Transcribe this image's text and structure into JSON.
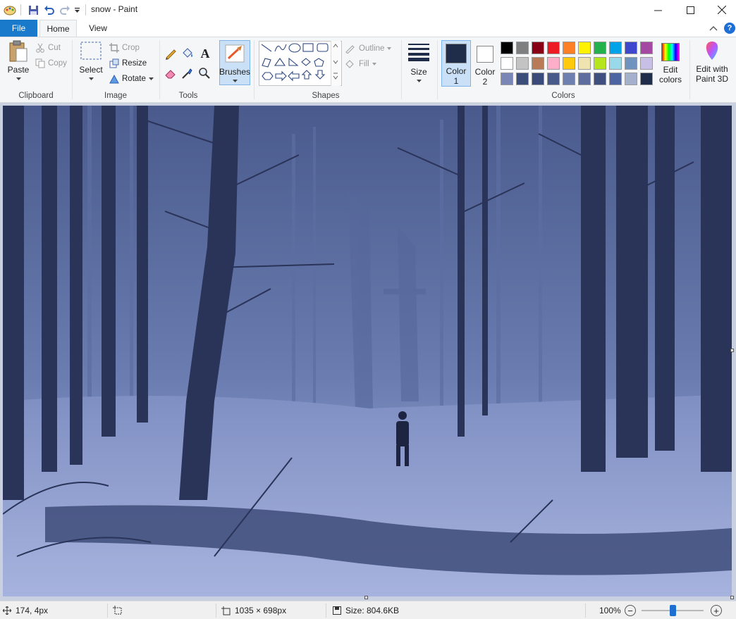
{
  "window": {
    "title": "snow - Paint",
    "minimize": "—",
    "maximize": "☐",
    "close": "✕"
  },
  "tabs": {
    "file": "File",
    "home": "Home",
    "view": "View"
  },
  "ribbon": {
    "clipboard": {
      "label": "Clipboard",
      "paste": "Paste",
      "cut": "Cut",
      "copy": "Copy"
    },
    "image": {
      "label": "Image",
      "select": "Select",
      "crop": "Crop",
      "resize": "Resize",
      "rotate": "Rotate"
    },
    "tools": {
      "label": "Tools"
    },
    "brushes": {
      "label": "Brushes"
    },
    "shapes": {
      "label": "Shapes",
      "outline": "Outline",
      "fill": "Fill"
    },
    "size": {
      "label": "Size"
    },
    "colors": {
      "label": "Colors",
      "color1_label": "Color",
      "color1_num": "1",
      "color2_label": "Color",
      "color2_num": "2",
      "edit_colors_line1": "Edit",
      "edit_colors_line2": "colors",
      "paint3d_line1": "Edit with",
      "paint3d_line2": "Paint 3D",
      "color1": "#1f2d4a",
      "color2": "#ffffff",
      "palette": [
        "#000000",
        "#7f7f7f",
        "#880015",
        "#ed1c24",
        "#ff7f27",
        "#fff200",
        "#22b14c",
        "#00a2e8",
        "#3f48cc",
        "#a349a4",
        "#ffffff",
        "#c3c3c3",
        "#b97a57",
        "#ffaec9",
        "#ffc90e",
        "#efe4b0",
        "#b5e61d",
        "#99d9ea",
        "#7092be",
        "#c8bfe7",
        "#7a86b5",
        "#3b4e79",
        "#3a4a7a",
        "#485a8a",
        "#6d80b0",
        "#5c6d9e",
        "#3e4f80",
        "#4c64a0",
        "#a4b0cc",
        "#1f2d4a"
      ]
    }
  },
  "status": {
    "cursor_pos": "174, 4px",
    "image_dims": "1035 × 698px",
    "file_size": "Size: 804.6KB",
    "zoom": "100%",
    "zoom_minus": "−",
    "zoom_plus": "+",
    "zoom_level": 0.5
  }
}
